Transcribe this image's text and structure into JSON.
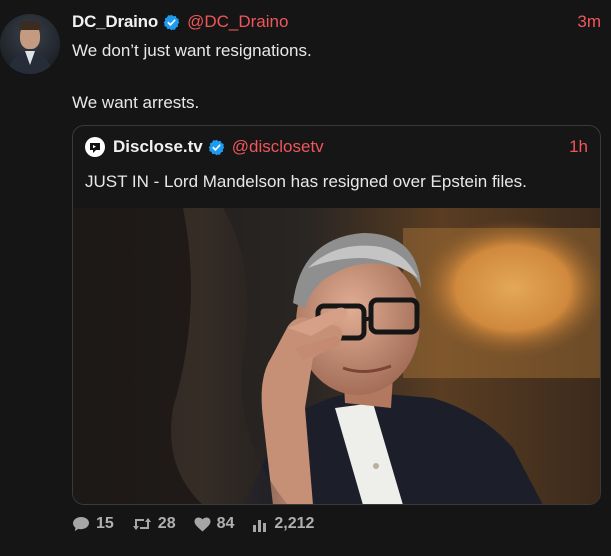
{
  "author": {
    "display_name": "DC_Draino",
    "handle": "@DC_Draino",
    "time": "3m",
    "avatar_icon": "profile-photo"
  },
  "tweet": {
    "paragraphs": [
      "We don’t just want resignations.",
      "We want arrests."
    ]
  },
  "quote": {
    "display_name": "Disclose.tv",
    "handle": "@disclosetv",
    "time": "1h",
    "text": "JUST IN - Lord Mandelson has resigned over Epstein files.",
    "avatar_icon": "disclose-tv-logo"
  },
  "actions": {
    "replies": "15",
    "retweets": "28",
    "likes": "84",
    "views": "2,212"
  },
  "colors": {
    "background": "#151515",
    "accent": "#f0565a",
    "verified": "#1d9bf0",
    "text": "#ececec",
    "muted": "#a6a6a6"
  }
}
